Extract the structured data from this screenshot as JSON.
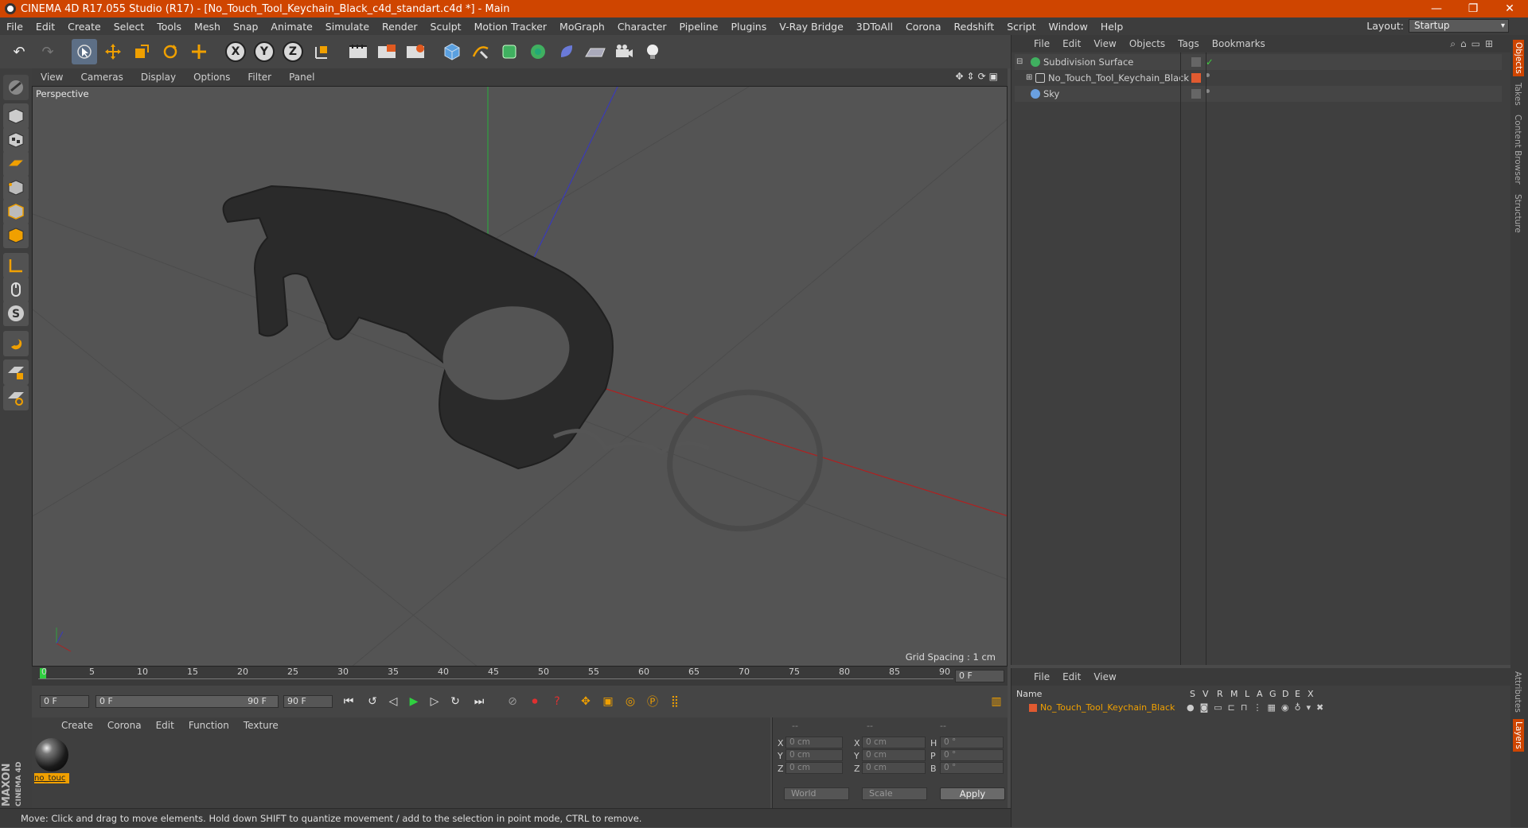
{
  "titlebar": {
    "title": "CINEMA 4D R17.055 Studio (R17) - [No_Touch_Tool_Keychain_Black_c4d_standart.c4d *] - Main",
    "min": "—",
    "max": "❐",
    "close": "✕"
  },
  "menubar": {
    "items": [
      "File",
      "Edit",
      "Create",
      "Select",
      "Tools",
      "Mesh",
      "Snap",
      "Animate",
      "Simulate",
      "Render",
      "Sculpt",
      "Motion Tracker",
      "MoGraph",
      "Character",
      "Pipeline",
      "Plugins",
      "V-Ray Bridge",
      "3DToAll",
      "Corona",
      "Redshift",
      "Script",
      "Window",
      "Help"
    ],
    "layout_label": "Layout:",
    "layout_value": "Startup"
  },
  "toolbar": {
    "undo": "↶",
    "redo": "↷",
    "x": "X",
    "y": "Y",
    "z": "Z"
  },
  "viewport": {
    "menu": [
      "View",
      "Cameras",
      "Display",
      "Options",
      "Filter",
      "Panel"
    ],
    "label": "Perspective",
    "grid_spacing": "Grid Spacing : 1 cm"
  },
  "timeline": {
    "ticks": [
      "0",
      "5",
      "10",
      "15",
      "20",
      "25",
      "30",
      "35",
      "40",
      "45",
      "50",
      "55",
      "60",
      "65",
      "70",
      "75",
      "80",
      "85",
      "90"
    ],
    "frame_field": "0 F"
  },
  "transport": {
    "start": "0 F",
    "range_start": "0 F",
    "range_end": "90 F",
    "end": "90 F"
  },
  "materials": {
    "menu": [
      "Create",
      "Corona",
      "Edit",
      "Function",
      "Texture"
    ],
    "mat_name": "no_touc"
  },
  "coords": {
    "headers": [
      "--",
      "--",
      "--"
    ],
    "x_pos": "0 cm",
    "y_pos": "0 cm",
    "z_pos": "0 cm",
    "x_size": "0 cm",
    "y_size": "0 cm",
    "z_size": "0 cm",
    "h": "0 °",
    "p": "0 °",
    "b": "0 °",
    "lx": "X",
    "ly": "Y",
    "lz": "Z",
    "lx2": "X",
    "ly2": "Y",
    "lz2": "Z",
    "lh": "H",
    "lp": "P",
    "lb": "B",
    "mode": "World",
    "scale": "Scale",
    "apply": "Apply"
  },
  "status": {
    "text": "Move: Click and drag to move elements. Hold down SHIFT to quantize movement / add to the selection in point mode, CTRL to remove."
  },
  "objects": {
    "menu": [
      "File",
      "Edit",
      "View",
      "Objects",
      "Tags",
      "Bookmarks"
    ],
    "items": [
      "Subdivision Surface",
      "No_Touch_Tool_Keychain_Black",
      "Sky"
    ]
  },
  "layers": {
    "menu": [
      "File",
      "Edit",
      "View"
    ],
    "head_name": "Name",
    "cols": [
      "S",
      "V",
      "R",
      "M",
      "L",
      "A",
      "G",
      "D",
      "E",
      "X"
    ],
    "row": "No_Touch_Tool_Keychain_Black"
  },
  "logo": {
    "line1": "MAXON",
    "line2": "CINEMA 4D"
  },
  "side_tabs": [
    "Objects",
    "Takes",
    "Content Browser",
    "Structure",
    "Attributes",
    "Layers"
  ],
  "colors": {
    "accent": "#cf4500",
    "highlight": "#f0a000"
  }
}
